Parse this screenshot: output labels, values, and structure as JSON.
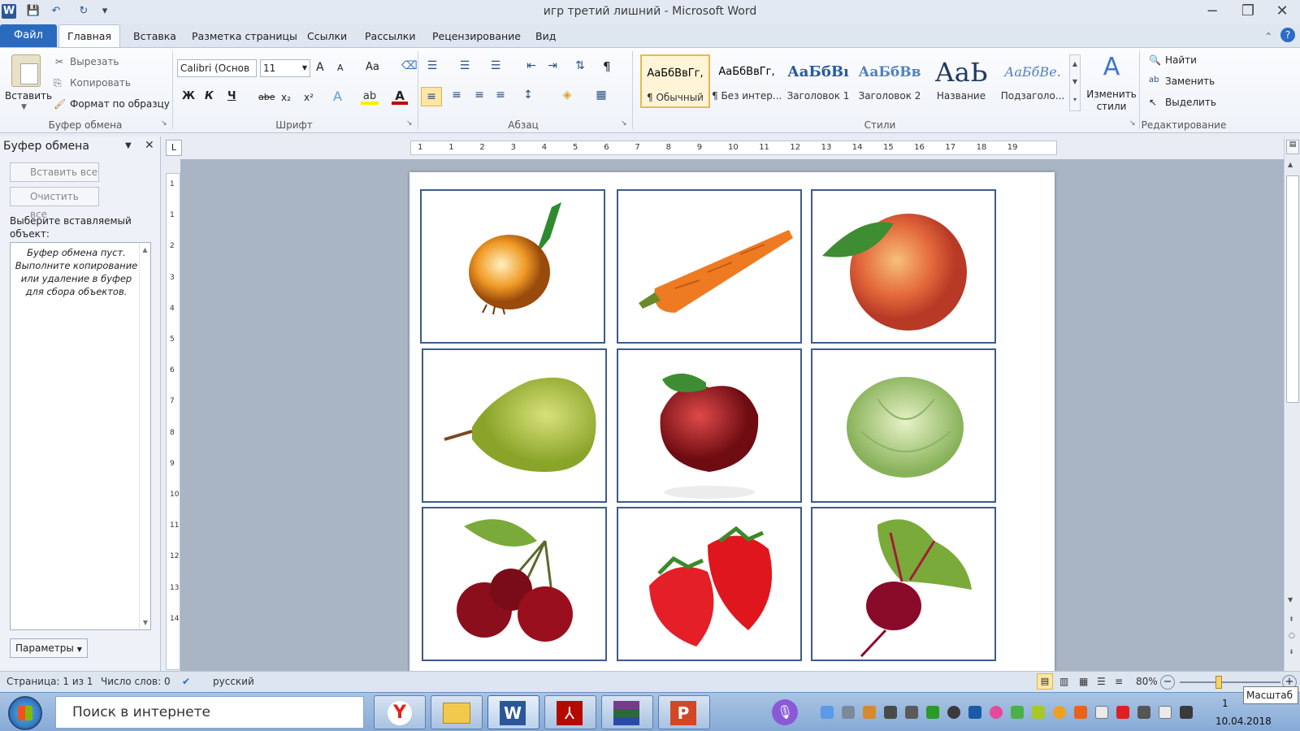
{
  "window": {
    "title": "игр третий лишний  -  Microsoft Word",
    "minimize": "−",
    "restore": "❐",
    "close": "✕"
  },
  "qat": {
    "word_icon": "W",
    "save": "💾",
    "undo": "↶",
    "redo": "↻",
    "customize": "▾"
  },
  "tabs": {
    "file": "Файл",
    "items": [
      "Главная",
      "Вставка",
      "Разметка страницы",
      "Ссылки",
      "Рассылки",
      "Рецензирование",
      "Вид"
    ]
  },
  "ribbon": {
    "clipboard": {
      "paste": "Вставить",
      "cut": "Вырезать",
      "copy": "Копировать",
      "format_painter": "Формат по образцу",
      "group": "Буфер обмена"
    },
    "font": {
      "name": "Calibri (Основ",
      "size": "11",
      "group": "Шрифт",
      "grow": "A",
      "shrink": "A",
      "case": "Aa",
      "bold": "Ж",
      "italic": "К",
      "underline": "Ч",
      "strike": "abe",
      "sub": "x₂",
      "sup": "x²"
    },
    "paragraph": {
      "group": "Абзац",
      "pilcrow": "¶"
    },
    "styles": {
      "group": "Стили",
      "items": [
        {
          "preview": "АаБбВвГг,",
          "label": "¶ Обычный"
        },
        {
          "preview": "АаБбВвГг,",
          "label": "¶ Без интер..."
        },
        {
          "preview": "АаБбВı",
          "label": "Заголовок 1"
        },
        {
          "preview": "АаБбВв",
          "label": "Заголовок 2"
        },
        {
          "preview": "АаЬ",
          "label": "Название"
        },
        {
          "preview": "АаБбВе.",
          "label": "Подзаголо..."
        }
      ],
      "change": "Изменить стили"
    },
    "editing": {
      "group": "Редактирование",
      "find": "Найти",
      "replace": "Заменить",
      "select": "Выделить"
    }
  },
  "pane": {
    "title": "Буфер обмена",
    "paste_all": "Вставить все",
    "clear_all": "Очистить все",
    "prompt": "Выберите вставляемый объект:",
    "empty": "Буфер обмена пуст. Выполните копирование или удаление в буфер для сбора объектов.",
    "options": "Параметры"
  },
  "ruler": {
    "h_ticks": [
      "1",
      "1",
      "2",
      "3",
      "4",
      "5",
      "6",
      "7",
      "8",
      "9",
      "10",
      "11",
      "12",
      "13",
      "14",
      "15",
      "16",
      "17",
      "18",
      "19"
    ],
    "v_ticks": [
      "1",
      "1",
      "2",
      "3",
      "4",
      "5",
      "6",
      "7",
      "8",
      "9",
      "10",
      "11",
      "12",
      "13",
      "14"
    ]
  },
  "cards": [
    {
      "name": "onion"
    },
    {
      "name": "carrot"
    },
    {
      "name": "peach"
    },
    {
      "name": "pear"
    },
    {
      "name": "apple"
    },
    {
      "name": "cabbage"
    },
    {
      "name": "cherry"
    },
    {
      "name": "strawberry"
    },
    {
      "name": "beet"
    }
  ],
  "status": {
    "page": "Страница: 1 из 1",
    "words": "Число слов: 0",
    "language": "русский",
    "zoom": "80%",
    "zoom_level": 0.8
  },
  "taskbar": {
    "search": "Поиск в интернете",
    "date": "10.04.2018",
    "tooltip": "Масштаб",
    "time_fragment": "1"
  },
  "colors": {
    "file_tab": "#2a6bbf",
    "card_border": "#3d5b88",
    "accent_blue": "#2b579a"
  }
}
